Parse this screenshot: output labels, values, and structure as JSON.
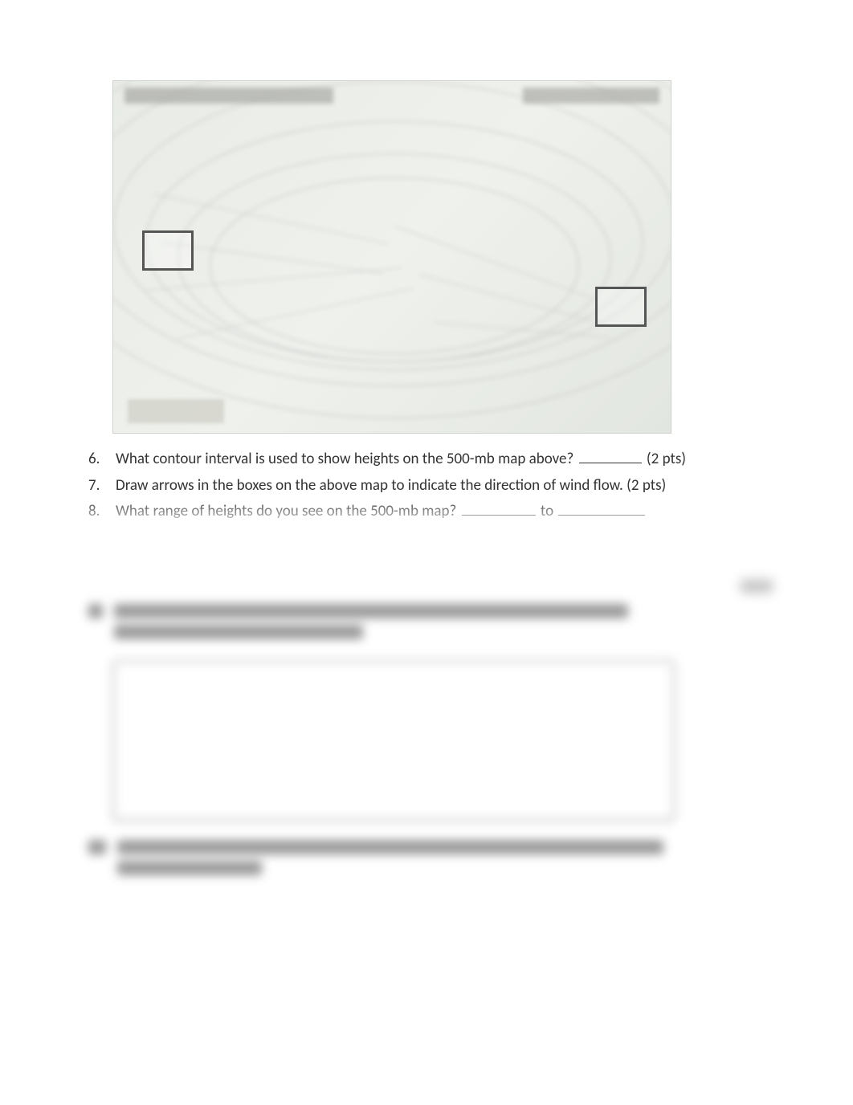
{
  "questions": [
    {
      "num": "6.",
      "text_before": "What contour interval is used to show heights on the 500-mb map above? ",
      "blank1_width": 78,
      "text_after": " (2 pts)"
    },
    {
      "num": "7.",
      "text_before": "Draw arrows in the boxes on the above map to indicate the direction of wind flow. (2 pts)",
      "blank1_width": 0,
      "text_after": ""
    },
    {
      "num": "8.",
      "text_before": "What range of heights do you see on the 500-mb map? ",
      "blank1_width": 92,
      "mid_text": " to ",
      "blank2_width": 108,
      "text_after": ""
    }
  ]
}
